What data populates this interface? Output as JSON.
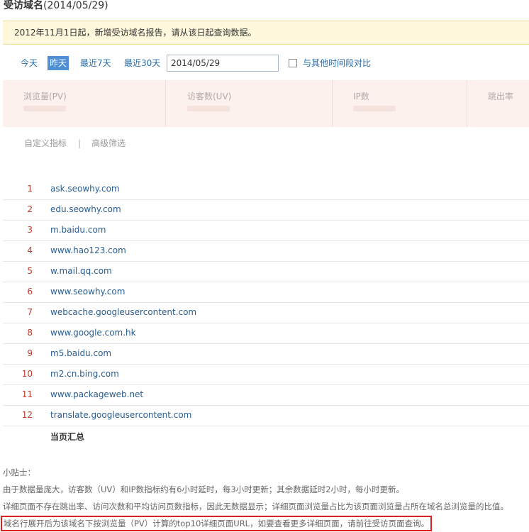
{
  "page": {
    "title": "受访域名",
    "title_date": "(2014/05/29)"
  },
  "notice": "2012年11月1日起，新增受访域名报告，请从该日起查询数据。",
  "date_filter": {
    "today": "今天",
    "yesterday": "昨天",
    "last7": "最近7天",
    "last30": "最近30天",
    "date_value": "2014/05/29",
    "compare_label": "与其他时间段对比"
  },
  "metrics": {
    "pv": "浏览量(PV)",
    "uv": "访客数(UV)",
    "ip": "IP数",
    "bounce": "跳出率"
  },
  "links": {
    "custom": "自定义指标",
    "divider": "|",
    "advanced": "高级筛选"
  },
  "domains": [
    {
      "rank": "1",
      "name": "ask.seowhy.com"
    },
    {
      "rank": "2",
      "name": "edu.seowhy.com"
    },
    {
      "rank": "3",
      "name": "m.baidu.com"
    },
    {
      "rank": "4",
      "name": "www.hao123.com"
    },
    {
      "rank": "5",
      "name": "w.mail.qq.com"
    },
    {
      "rank": "6",
      "name": "www.seowhy.com"
    },
    {
      "rank": "7",
      "name": "webcache.googleusercontent.com"
    },
    {
      "rank": "8",
      "name": "www.google.com.hk"
    },
    {
      "rank": "9",
      "name": "m5.baidu.com"
    },
    {
      "rank": "10",
      "name": "m2.cn.bing.com"
    },
    {
      "rank": "11",
      "name": "www.packageweb.net"
    },
    {
      "rank": "12",
      "name": "translate.googleusercontent.com"
    }
  ],
  "summary_label": "当页汇总",
  "tips": {
    "heading": "小贴士：",
    "line1": "由于数据量庞大，访客数（UV）和IP数指标约有6小时延时，每3小时更新；其余数据延时2小时，每小时更新。",
    "line2": "详细页面不存在跳出率、访问次数和平均访问页数指标，因此无数据显示；详细页面浏览量占比为该页面浏览量占所在域名总浏览量的比值。",
    "line3": "域名行展开后为该域名下按浏览量（PV）计算的top10详细页面URL，如要查看更多详细页面，请前往受访页面查询。"
  }
}
